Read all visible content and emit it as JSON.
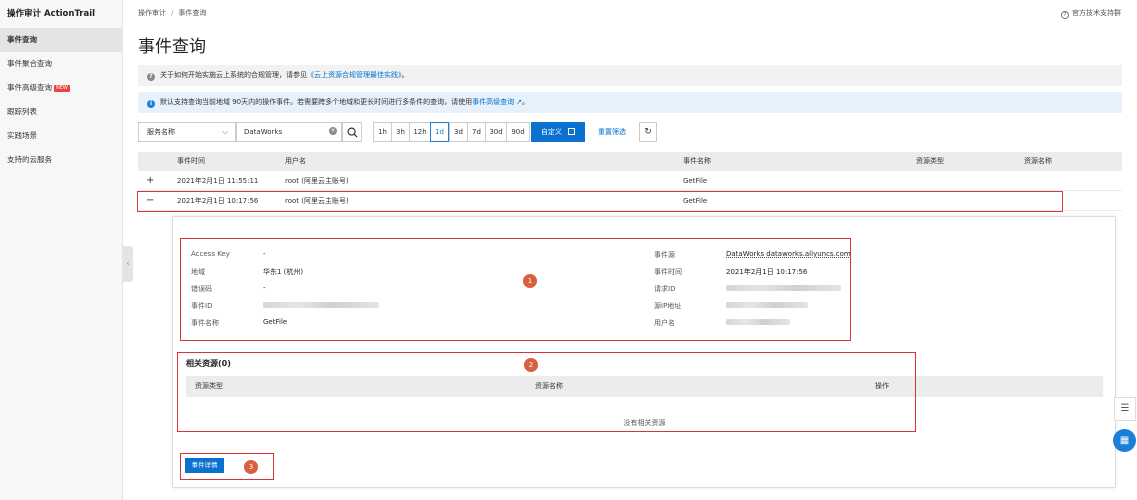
{
  "sidebar": {
    "title": "操作审计 ActionTrail",
    "items": [
      {
        "label": "事件查询",
        "active": true
      },
      {
        "label": "事件聚合查询"
      },
      {
        "label": "事件高级查询",
        "badge": "NEW"
      },
      {
        "label": "跟踪列表"
      },
      {
        "label": "实践场景"
      },
      {
        "label": "支持的云服务"
      }
    ]
  },
  "breadcrumb": {
    "root": "操作审计",
    "sep": "/",
    "current": "事件查询"
  },
  "help": {
    "icon": "question-circle-icon",
    "label": "官方技术支持群"
  },
  "page_title": "事件查询",
  "notice1": {
    "prefix": "关于如何开始实施云上系统的合规管理，请参见",
    "link": "《云上资源合规管理最佳实践》",
    "suffix": "。"
  },
  "notice2": {
    "prefix": "默认支持查询当前地域 90天内的操作事件。若需要跨多个地域和更长时间进行多条件的查询，请使用",
    "link": "事件高级查询",
    "suffix": "。"
  },
  "filters": {
    "service_select": "服务名称",
    "service_value": "DataWorks",
    "time_buttons": [
      "1h",
      "3h",
      "12h",
      "1d",
      "3d",
      "7d",
      "30d",
      "90d"
    ],
    "selected_time": "1d",
    "custom_label": "自定义",
    "reset_label": "重置筛选"
  },
  "table": {
    "headers": [
      "事件时间",
      "用户名",
      "事件名称",
      "资源类型",
      "资源名称"
    ],
    "rows": [
      {
        "expander": "+",
        "time": "2021年2月1日 11:55:11",
        "user": "root (阿里云主账号)",
        "event": "GetFile"
      },
      {
        "expander": "−",
        "time": "2021年2月1日 10:17:56",
        "user": "root (阿里云主账号)",
        "event": "GetFile"
      }
    ]
  },
  "detail": {
    "left": [
      {
        "label": "Access Key",
        "value": "-"
      },
      {
        "label": "地域",
        "value": "华东1 (杭州)"
      },
      {
        "label": "错误码",
        "value": "-"
      },
      {
        "label": "事件ID",
        "value": ""
      },
      {
        "label": "事件名称",
        "value": "GetFile"
      }
    ],
    "right": [
      {
        "label": "事件源",
        "value": "DataWorks dataworks.aliyuncs.com"
      },
      {
        "label": "事件时间",
        "value": "2021年2月1日 10:17:56"
      },
      {
        "label": "请求ID",
        "value": ""
      },
      {
        "label": "源IP地址",
        "value": ""
      },
      {
        "label": "用户名",
        "value": ""
      }
    ],
    "related_title": "相关资源(0)",
    "related_headers": [
      "资源类型",
      "资源名称",
      "操作"
    ],
    "related_empty": "没有相关资源",
    "details_button": "事件详情",
    "annotations": [
      "1",
      "2",
      "3"
    ]
  },
  "colors": {
    "accent": "#0a71cf",
    "highlight": "#d9343a",
    "badge": "#d8603e"
  }
}
